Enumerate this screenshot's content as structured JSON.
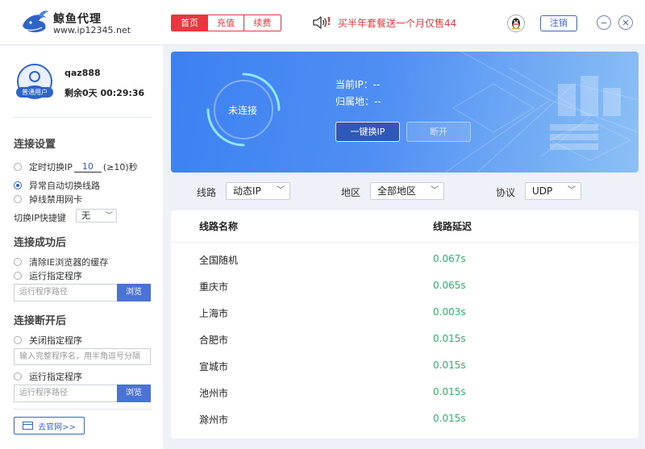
{
  "header": {
    "brand_name": "鲸鱼代理",
    "brand_url": "www.ip12345.net",
    "nav_tabs": [
      {
        "label": "首页",
        "active": true
      },
      {
        "label": "充值",
        "active": false
      },
      {
        "label": "续费",
        "active": false
      }
    ],
    "promo_bang": "!",
    "promo_text": "买半年套餐送一个月仅售44",
    "logout_label": "注销",
    "min_glyph": "−",
    "close_glyph": "✕"
  },
  "user": {
    "badge": "普通用户",
    "name": "qaz888",
    "remaining": "剩余0天 00:29:36"
  },
  "settings": {
    "connect_title": "连接设置",
    "timed_switch_prefix": "定时切换IP",
    "timed_switch_value": "10",
    "timed_switch_suffix": "(≥10)秒",
    "auto_switch": "异常自动切换线路",
    "disable_nic": "掉线禁用网卡",
    "hotkey_label": "切换IP快捷键",
    "hotkey_value": "无",
    "success_title": "连接成功后",
    "clear_cache": "清除IE浏览器的缓存",
    "run_program": "运行指定程序",
    "path_placeholder": "运行程序路径",
    "browse_label": "浏览",
    "disconnect_title": "连接断开后",
    "close_program": "关闭指定程序",
    "close_placeholder": "输入完整程序名，用半角逗号分隔",
    "run_program2": "运行指定程序",
    "path_placeholder2": "运行程序路径",
    "browse_label2": "浏览",
    "site_button": "去官网>>"
  },
  "banner": {
    "status": "未连接",
    "current_ip_label": "当前IP：--",
    "location_label": "归属地：--",
    "oneclick_label": "一键换IP",
    "disconnect_label": "断开"
  },
  "filters": {
    "line_label": "线路",
    "line_value": "动态IP",
    "region_label": "地区",
    "region_value": "全部地区",
    "protocol_label": "协议",
    "protocol_value": "UDP"
  },
  "table": {
    "col_name": "线路名称",
    "col_delay": "线路延迟",
    "rows": [
      {
        "name": "全国随机",
        "delay": "0.067s"
      },
      {
        "name": "重庆市",
        "delay": "0.065s"
      },
      {
        "name": "上海市",
        "delay": "0.003s"
      },
      {
        "name": "合肥市",
        "delay": "0.015s"
      },
      {
        "name": "宣城市",
        "delay": "0.015s"
      },
      {
        "name": "池州市",
        "delay": "0.015s"
      },
      {
        "name": "滁州市",
        "delay": "0.015s"
      }
    ]
  },
  "colors": {
    "accent_red": "#e8373f",
    "brand_blue": "#2e64c8",
    "delay_green": "#27b768"
  }
}
